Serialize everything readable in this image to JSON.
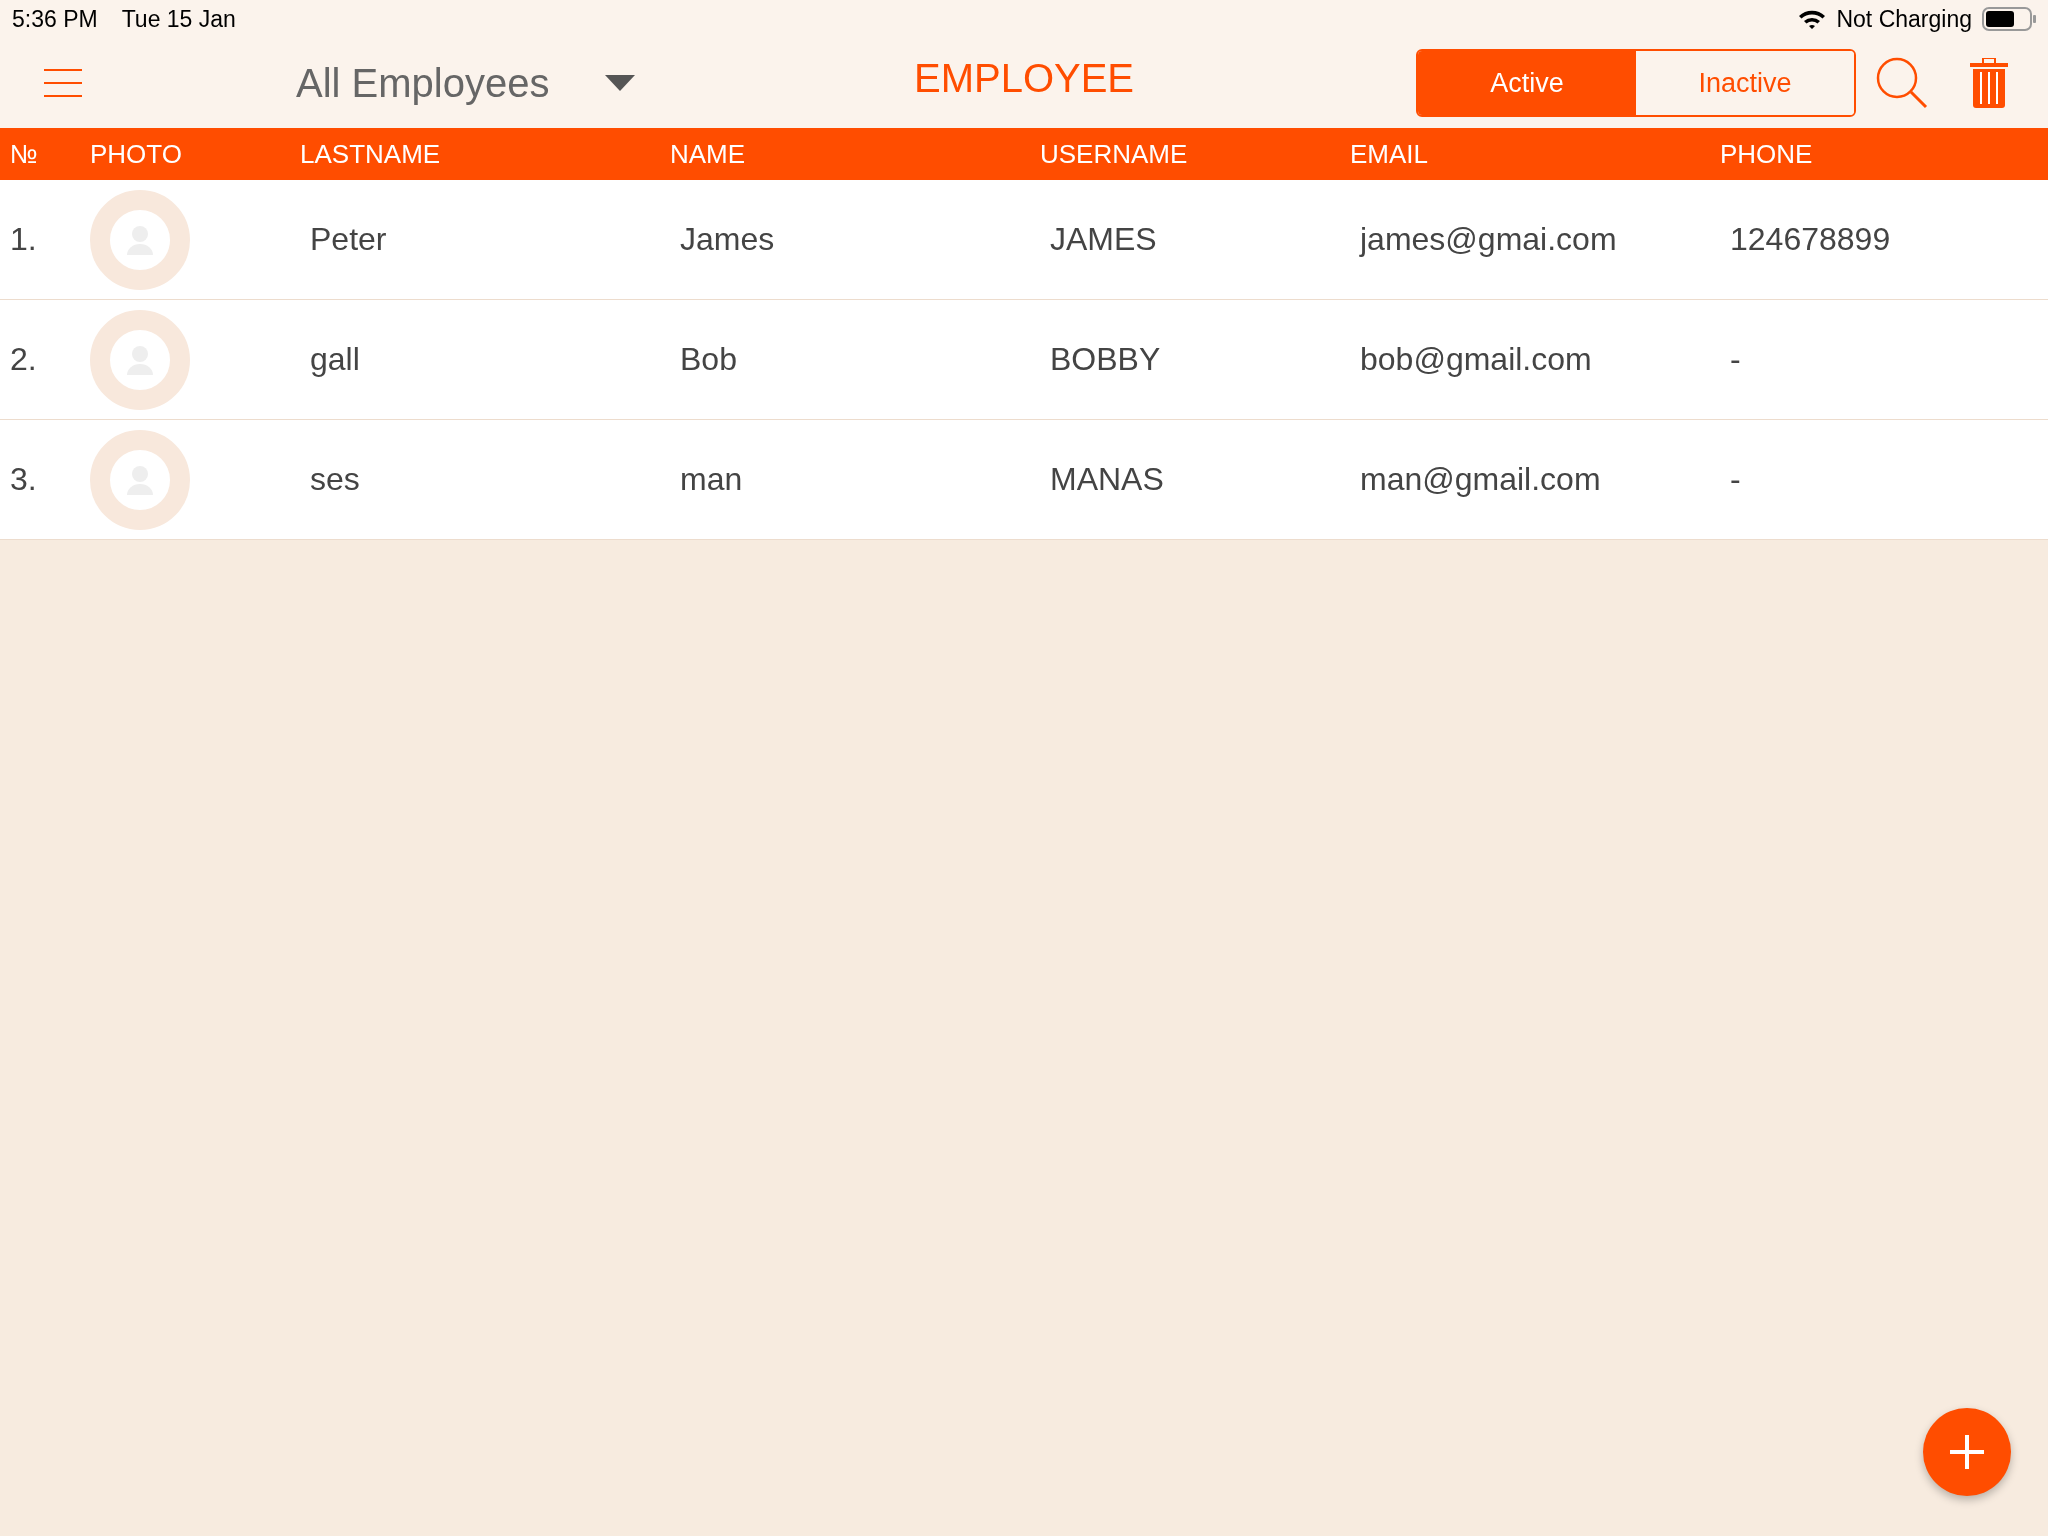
{
  "status_bar": {
    "time": "5:36 PM",
    "date": "Tue 15 Jan",
    "battery_label": "Not Charging"
  },
  "header": {
    "filter": "All Employees",
    "title": "EMPLOYEE",
    "segments": [
      {
        "label": "Active",
        "selected": true
      },
      {
        "label": "Inactive",
        "selected": false
      }
    ]
  },
  "table": {
    "columns": [
      "№",
      "PHOTO",
      "LASTNAME",
      "NAME",
      "USERNAME",
      "EMAIL",
      "PHONE"
    ],
    "rows": [
      {
        "number": "1.",
        "lastname": "Peter",
        "name": "James",
        "username": "JAMES",
        "email": "james@gmai.com",
        "phone": "124678899"
      },
      {
        "number": "2.",
        "lastname": "gall",
        "name": "Bob",
        "username": "BOBBY",
        "email": "bob@gmail.com",
        "phone": "-"
      },
      {
        "number": "3.",
        "lastname": "ses",
        "name": "man",
        "username": "MANAS",
        "email": "man@gmail.com",
        "phone": "-"
      }
    ]
  }
}
